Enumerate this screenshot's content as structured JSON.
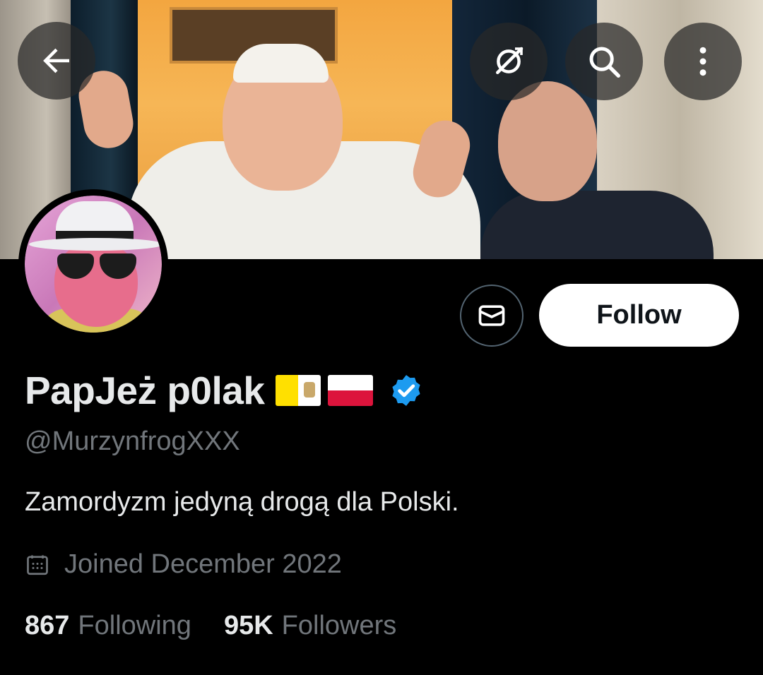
{
  "profile": {
    "display_name": "PapJeż p0lak",
    "handle": "@MurzynfrogXXX",
    "bio": "Zamordyzm jedyną drogą dla Polski.",
    "joined": "Joined December 2022",
    "verified": true,
    "flags": [
      "vatican-flag-icon",
      "poland-flag-icon"
    ]
  },
  "stats": {
    "following_count": "867",
    "following_label": "Following",
    "followers_count": "95K",
    "followers_label": "Followers"
  },
  "actions": {
    "follow_label": "Follow"
  },
  "icons": {
    "back": "arrow-left-icon",
    "grok": "grok-icon",
    "search": "search-icon",
    "more": "more-vertical-icon",
    "message": "envelope-icon",
    "calendar": "calendar-icon",
    "verified": "verified-badge-icon"
  },
  "colors": {
    "background": "#000000",
    "primary_text": "#e7e9ea",
    "secondary_text": "#71767b",
    "verified_blue": "#1d9bf0",
    "follow_button_bg": "#ffffff"
  }
}
